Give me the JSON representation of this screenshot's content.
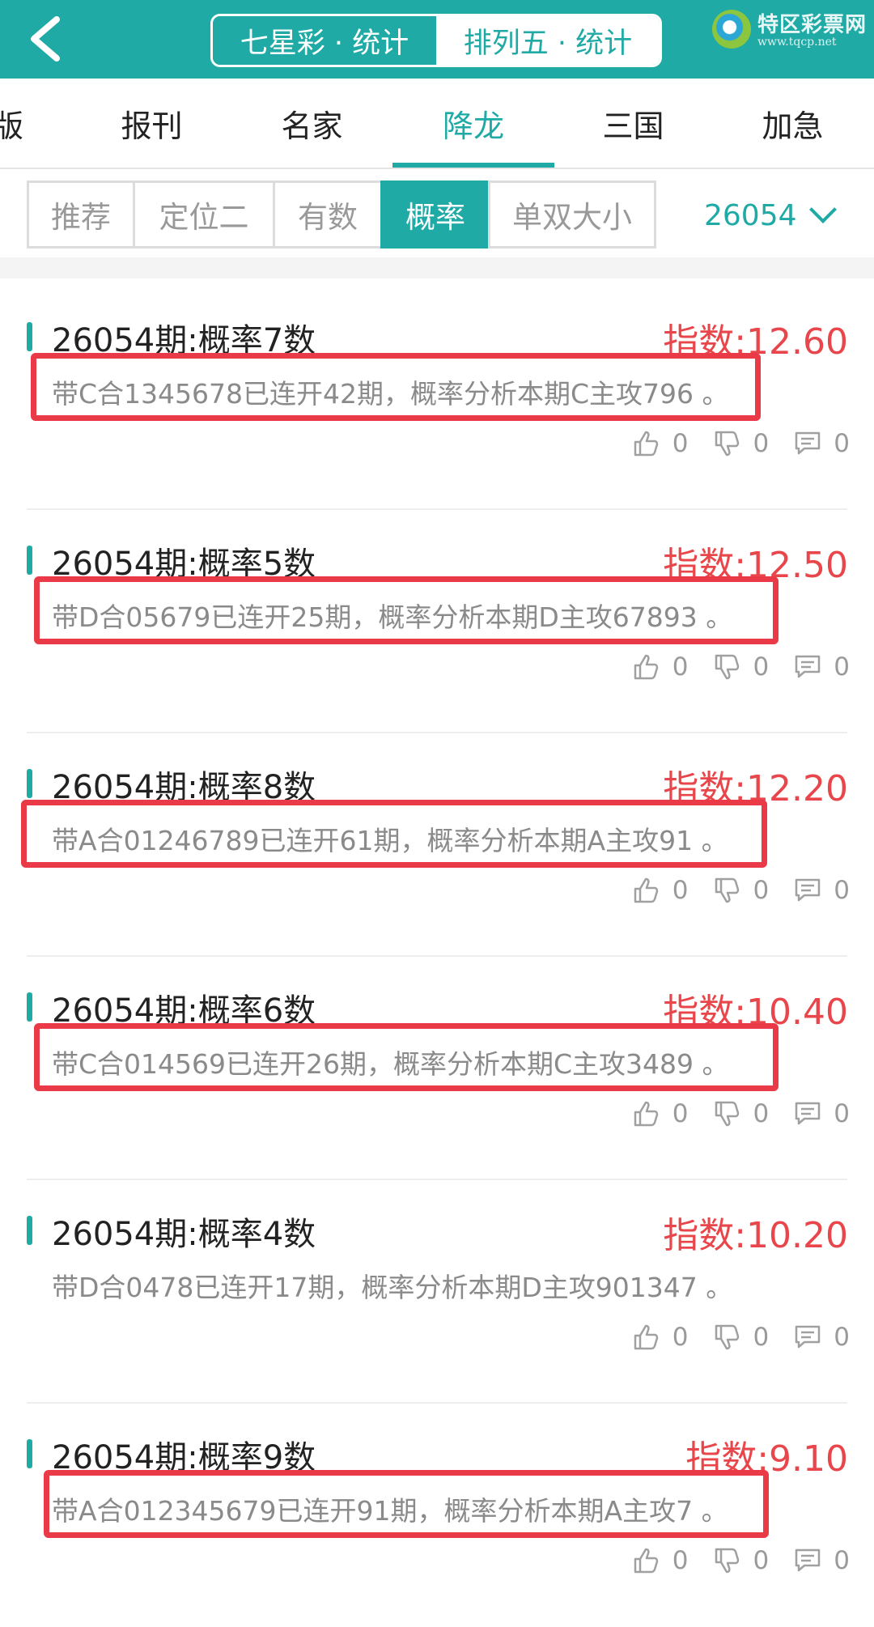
{
  "header": {
    "seg_left": "七星彩 · 统计",
    "seg_right": "排列五 · 统计",
    "logo_text": "特区彩票网",
    "logo_url": "www.tqcp.net"
  },
  "tabs": [
    "版",
    "报刊",
    "名家",
    "降龙",
    "三国",
    "加急"
  ],
  "filters": [
    "推荐",
    "定位二",
    "有数",
    "概率",
    "单双大小"
  ],
  "issue": "26054",
  "colors": {
    "accent": "#1faaa5",
    "index_red": "#e8464a",
    "highlight_red": "#ea3a48"
  },
  "cards": [
    {
      "title": "26054期:概率7数",
      "index": "指数:12.60",
      "desc": "带C合1345678已连开42期，概率分析本期C主攻796 。",
      "likes": "0",
      "dislikes": "0",
      "comments": "0"
    },
    {
      "title": "26054期:概率5数",
      "index": "指数:12.50",
      "desc": "带D合05679已连开25期，概率分析本期D主攻67893 。",
      "likes": "0",
      "dislikes": "0",
      "comments": "0"
    },
    {
      "title": "26054期:概率8数",
      "index": "指数:12.20",
      "desc": "带A合01246789已连开61期，概率分析本期A主攻91 。",
      "likes": "0",
      "dislikes": "0",
      "comments": "0"
    },
    {
      "title": "26054期:概率6数",
      "index": "指数:10.40",
      "desc": "带C合014569已连开26期，概率分析本期C主攻3489 。",
      "likes": "0",
      "dislikes": "0",
      "comments": "0"
    },
    {
      "title": "26054期:概率4数",
      "index": "指数:10.20",
      "desc": "带D合0478已连开17期，概率分析本期D主攻901347 。",
      "likes": "0",
      "dislikes": "0",
      "comments": "0"
    },
    {
      "title": "26054期:概率9数",
      "index": "指数:9.10",
      "desc": "带A合012345679已连开91期，概率分析本期A主攻7 。",
      "likes": "0",
      "dislikes": "0",
      "comments": "0"
    }
  ]
}
